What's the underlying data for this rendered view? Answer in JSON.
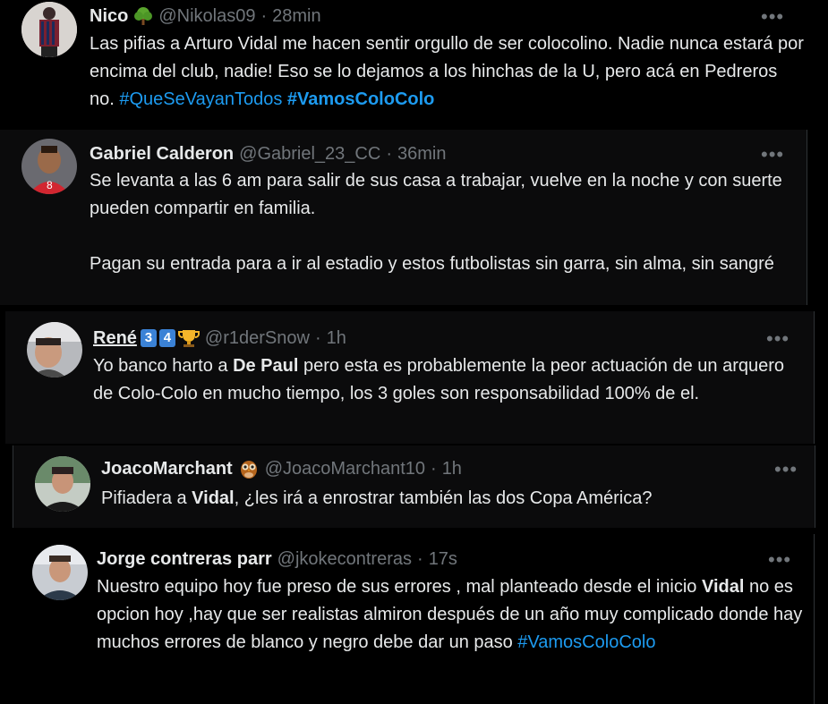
{
  "tweets": [
    {
      "name": "Nico",
      "handle": "@Nikolas09",
      "time": "28min",
      "more": "•••",
      "body": [
        {
          "text": "Las pifias a Arturo Vidal me hacen sentir orgullo de ser colocolino. Nadie nunca estará por encima del club, nadie! Eso se lo dejamos a los hinchas de la U, pero acá en Pedreros no. "
        },
        {
          "text": "#QueSeVayanTodos",
          "style": "link"
        },
        {
          "text": " "
        },
        {
          "text": "#VamosColoColo",
          "style": "link-bold"
        }
      ]
    },
    {
      "name": "Gabriel Calderon",
      "handle": "@Gabriel_23_CC",
      "time": "36min",
      "more": "•••",
      "paragraph1": "Se levanta a las 6 am para salir de sus casa a trabajar, vuelve en la noche y con suerte pueden compartir en familia.",
      "paragraph2": "Pagan su entrada para a ir al estadio y estos futbolistas sin garra, sin alma, sin sangré"
    },
    {
      "name": "René",
      "badge1": "3",
      "badge2": "4",
      "handle": "@r1derSnow",
      "time": "1h",
      "more": "•••",
      "body": [
        {
          "text": "Yo banco harto a "
        },
        {
          "text": "De Paul",
          "style": "bold"
        },
        {
          "text": " pero esta es probablemente la peor actuación de un arquero de Colo-Colo en mucho tiempo, los 3 goles son responsabilidad 100% de el."
        }
      ]
    },
    {
      "name": "JoacoMarchant",
      "handle": "@JoacoMarchant10",
      "time": "1h",
      "more": "•••",
      "body": [
        {
          "text": "Pifiadera a "
        },
        {
          "text": "Vidal",
          "style": "bold"
        },
        {
          "text": ", ¿les irá a enrostrar también las dos Copa América?"
        }
      ]
    },
    {
      "name": "Jorge contreras parr",
      "handle": "@jkokecontreras",
      "time": "17s",
      "more": "•••",
      "body": [
        {
          "text": "Nuestro equipo hoy fue preso de sus errores , mal planteado desde el inicio "
        },
        {
          "text": "Vidal",
          "style": "bold"
        },
        {
          "text": " no es opcion hoy ,hay que ser realistas almiron después de un año muy complicado donde hay muchos errores de blanco y negro debe dar un paso  "
        },
        {
          "text": "#VamosColoColo",
          "style": "link"
        }
      ]
    }
  ],
  "separator": "·",
  "colors": {
    "background": "#000000",
    "text": "#e7e9ea",
    "muted": "#71767b",
    "link": "#1d9bf0"
  },
  "icons": {
    "tree": "tree-emoji-icon",
    "owl": "owl-emoji-icon",
    "trophy": "trophy-emoji-icon",
    "more": "more-dots-icon"
  }
}
